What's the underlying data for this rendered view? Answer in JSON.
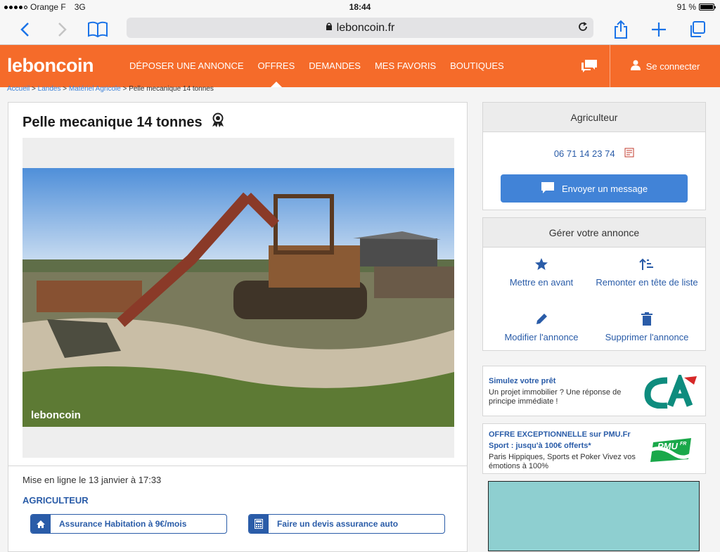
{
  "status_bar": {
    "carrier": "Orange F",
    "network": "3G",
    "time": "18:44",
    "battery": "91 %"
  },
  "browser": {
    "url": "leboncoin.fr"
  },
  "header": {
    "logo": "leboncoin",
    "nav": [
      "DÉPOSER UNE ANNONCE",
      "OFFRES",
      "DEMANDES",
      "MES FAVORIS",
      "BOUTIQUES"
    ],
    "active_nav": "OFFRES",
    "login_label": "Se connecter",
    "brand_color": "#f56b2a"
  },
  "breadcrumb": {
    "items": [
      "Accueil",
      "Landes",
      "Matériel Agricole"
    ],
    "current": "Pelle mecanique 14 tonnes",
    "sep": ">"
  },
  "ad": {
    "title": "Pelle mecanique 14 tonnes",
    "photo_watermark": "leboncoin",
    "posted": "Mise en ligne le 13 janvier à 17:33",
    "category": "AGRICULTEUR",
    "cta_home": "Assurance Habitation à 9€/mois",
    "cta_auto": "Faire un devis assurance auto"
  },
  "seller": {
    "name": "Agriculteur",
    "phone": "06 71 14 23 74",
    "send_message": "Envoyer un message",
    "button_color": "#4183d7"
  },
  "manage": {
    "title": "Gérer votre annonce",
    "feature": "Mettre en avant",
    "bump": "Remonter en tête de liste",
    "edit": "Modifier l'annonce",
    "delete": "Supprimer l'annonce"
  },
  "promos": [
    {
      "title": "Simulez votre prêt",
      "text": "Un projet immobilier ? Une réponse de principe immédiate !",
      "logo": "credit-agricole-logo"
    },
    {
      "title": "OFFRE EXCEPTIONNELLE sur PMU.Fr Sport : jusqu'à 100€ offerts*",
      "text": "Paris Hippiques, Sports et Poker Vivez vos émotions à 100%",
      "logo": "pmu-logo"
    }
  ]
}
